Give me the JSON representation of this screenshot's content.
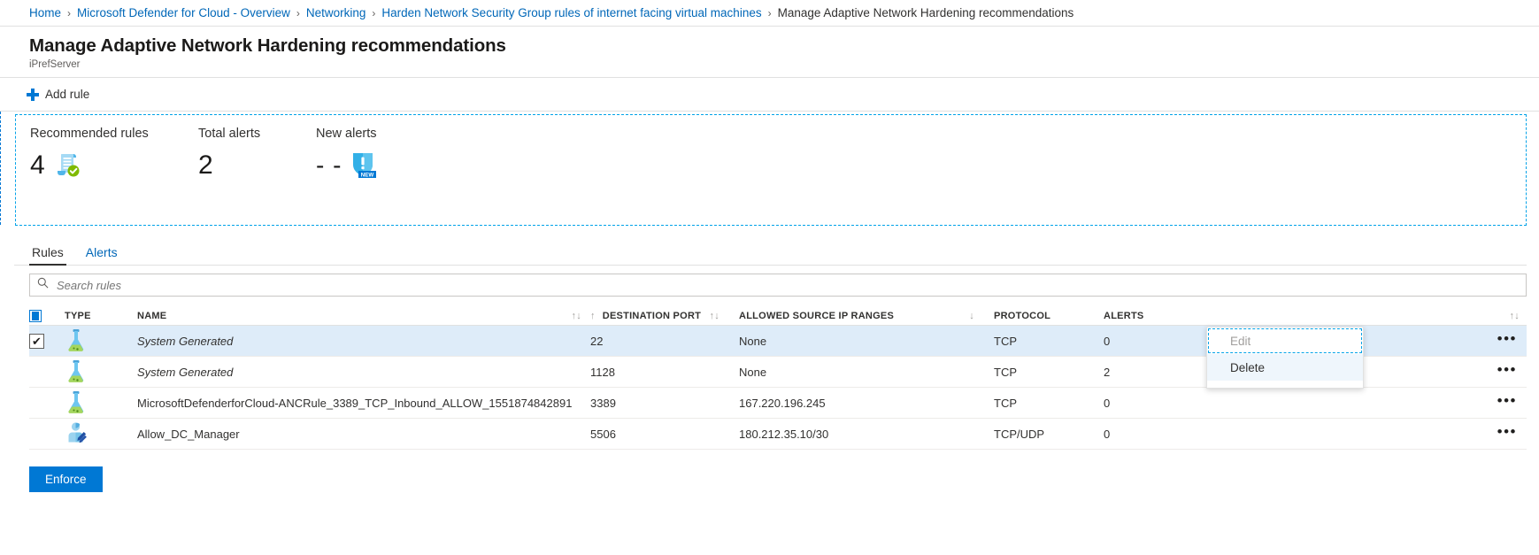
{
  "breadcrumb": {
    "items": [
      {
        "label": "Home",
        "current": false
      },
      {
        "label": "Microsoft Defender for Cloud - Overview",
        "current": false
      },
      {
        "label": "Networking",
        "current": false
      },
      {
        "label": "Harden Network Security Group rules of internet facing virtual machines",
        "current": false
      },
      {
        "label": "Manage Adaptive Network Hardening recommendations",
        "current": true
      }
    ],
    "separator": "›"
  },
  "header": {
    "title": "Manage Adaptive Network Hardening recommendations",
    "subtitle": "iPrefServer"
  },
  "commandbar": {
    "add_rule_label": "Add rule",
    "add_rule_icon": "plus-icon"
  },
  "stats": [
    {
      "label": "Recommended rules",
      "value": "4",
      "icon": "scroll-check-icon"
    },
    {
      "label": "Total alerts",
      "value": "2",
      "icon": "none"
    },
    {
      "label": "New alerts",
      "value": "- -",
      "icon": "shield-new-alert-icon"
    }
  ],
  "tabs": [
    {
      "label": "Rules",
      "active": true
    },
    {
      "label": "Alerts",
      "active": false
    }
  ],
  "search": {
    "placeholder": "Search rules",
    "value": "",
    "icon": "search-icon"
  },
  "table": {
    "columns": [
      {
        "key": "type",
        "label": "TYPE",
        "sortable": false
      },
      {
        "key": "name",
        "label": "NAME",
        "sortable": true,
        "sort_icon": "↑↓"
      },
      {
        "key": "dport",
        "label": "DESTINATION PORT",
        "sortable": true,
        "sort_icon": "↑↓"
      },
      {
        "key": "srcip",
        "label": "ALLOWED SOURCE IP RANGES",
        "sortable": true,
        "sort_icon": "↑↓"
      },
      {
        "key": "proto",
        "label": "PROTOCOL",
        "sortable": false
      },
      {
        "key": "alerts",
        "label": "ALERTS",
        "sortable": false
      }
    ],
    "name_col_sort_icon": "↑↓",
    "pre_dport_sort_icon": "↑",
    "pre_srcip_sort_icon": "↓",
    "trailing_sort_icon": "↑↓",
    "rows": [
      {
        "selected": true,
        "checked": true,
        "type_icon": "flask-icon",
        "name": "System Generated",
        "name_italic": true,
        "dport": "22",
        "srcip": "None",
        "proto": "TCP",
        "alerts": "0",
        "menu_label": "•••"
      },
      {
        "selected": false,
        "checked": false,
        "type_icon": "flask-icon",
        "name": "System Generated",
        "name_italic": true,
        "dport": "1128",
        "srcip": "None",
        "proto": "TCP",
        "alerts": "2",
        "menu_label": "•••"
      },
      {
        "selected": false,
        "checked": false,
        "type_icon": "flask-icon",
        "name": "MicrosoftDefenderforCloud-ANCRule_3389_TCP_Inbound_ALLOW_1551874842891",
        "name_italic": false,
        "dport": "3389",
        "srcip": "167.220.196.245",
        "proto": "TCP",
        "alerts": "0",
        "menu_label": "•••"
      },
      {
        "selected": false,
        "checked": false,
        "type_icon": "user-edit-icon",
        "name": "Allow_DC_Manager",
        "name_italic": false,
        "dport": "5506",
        "srcip": "180.212.35.10/30",
        "proto": "TCP/UDP",
        "alerts": "0",
        "menu_label": "•••"
      }
    ]
  },
  "context_menu": {
    "items": [
      {
        "label": "Edit",
        "disabled": true,
        "focused": true
      },
      {
        "label": "Delete",
        "disabled": false,
        "focused": false
      }
    ]
  },
  "footer": {
    "enforce_label": "Enforce"
  },
  "colors": {
    "link": "#0067b8",
    "accent": "#0078d4",
    "selected_row": "#deecf9",
    "focus_dashed": "#00a2e8",
    "text": "#323130"
  }
}
